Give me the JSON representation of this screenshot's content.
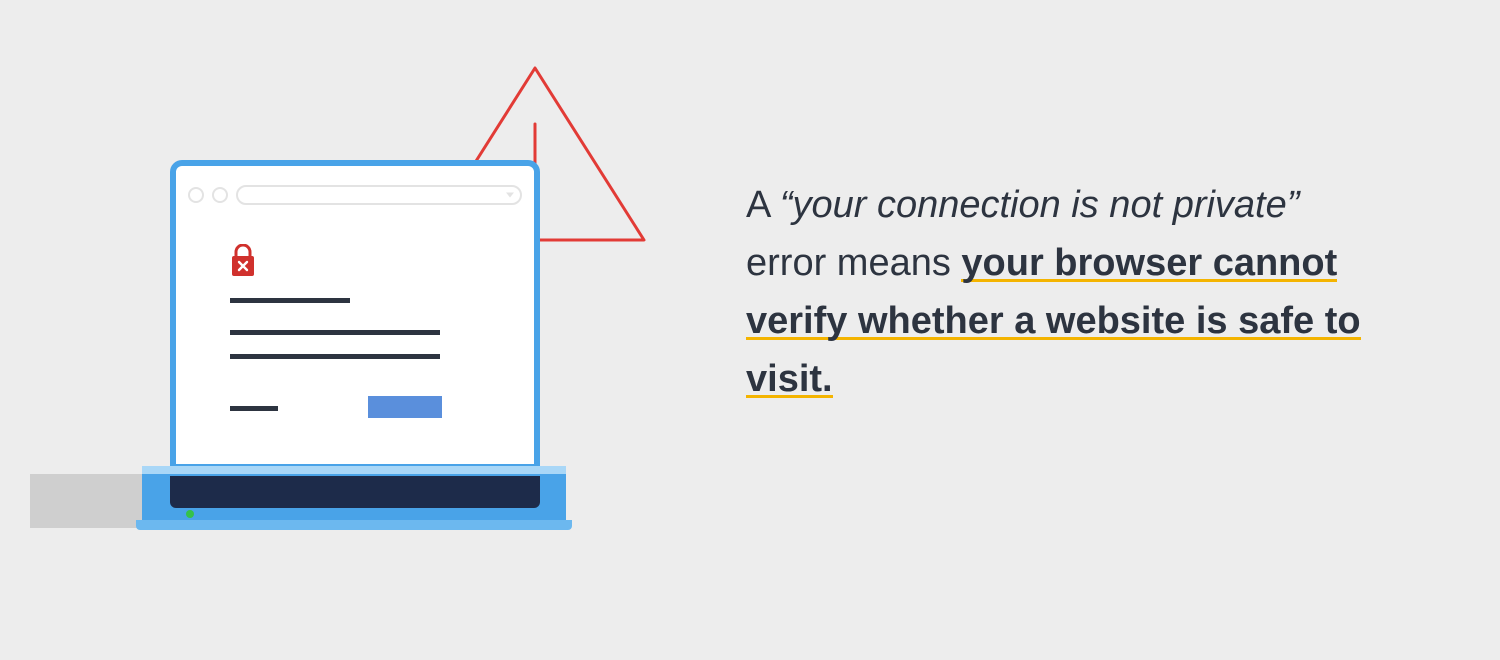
{
  "text": {
    "prefix": "A ",
    "quoted": "“your connection is not private”",
    "mid": " error means ",
    "bold": "your browser cannot verify whether a website is safe to visit."
  },
  "icons": {
    "warning": "warning-triangle-icon",
    "lock": "lock-error-icon",
    "power": "power-led-icon"
  },
  "colors": {
    "bg": "#ededed",
    "text": "#2d3440",
    "underline": "#f4b400",
    "laptop_blue": "#49a3e8",
    "laptop_dark": "#1d2b4a",
    "button_blue": "#5a8fdc",
    "warning_red": "#e23b36",
    "led_green": "#35c24a"
  }
}
